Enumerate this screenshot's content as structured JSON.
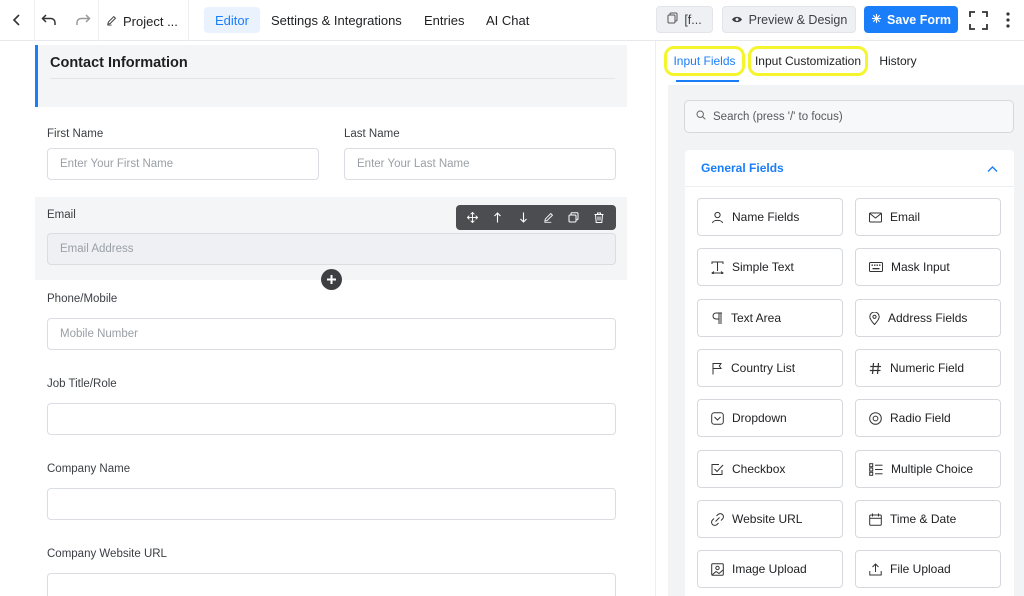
{
  "topbar": {
    "project_name": "Project ...",
    "tabs": [
      "Editor",
      "Settings & Integrations",
      "Entries",
      "AI Chat"
    ],
    "shortcode_label": "[f...",
    "preview_label": "Preview & Design",
    "save_label": "Save Form"
  },
  "form": {
    "section_title": "Contact Information",
    "first_name_label": "First Name",
    "first_name_placeholder": "Enter Your First Name",
    "last_name_label": "Last Name",
    "last_name_placeholder": "Enter Your Last Name",
    "email_label": "Email",
    "email_placeholder": "Email Address",
    "phone_label": "Phone/Mobile",
    "phone_placeholder": "Mobile Number",
    "job_label": "Job Title/Role",
    "company_label": "Company Name",
    "website_label": "Company Website URL"
  },
  "panel": {
    "tabs": [
      "Input Fields",
      "Input Customization",
      "History"
    ],
    "search_placeholder": "Search (press '/' to focus)",
    "group_title": "General Fields",
    "fields": [
      {
        "label": "Name Fields",
        "icon": "user-icon"
      },
      {
        "label": "Email",
        "icon": "mail-icon"
      },
      {
        "label": "Simple Text",
        "icon": "text-icon"
      },
      {
        "label": "Mask Input",
        "icon": "keyboard-icon"
      },
      {
        "label": "Text Area",
        "icon": "paragraph-icon"
      },
      {
        "label": "Address Fields",
        "icon": "location-pin-icon"
      },
      {
        "label": "Country List",
        "icon": "flag-icon"
      },
      {
        "label": "Numeric Field",
        "icon": "hash-icon"
      },
      {
        "label": "Dropdown",
        "icon": "dropdown-icon"
      },
      {
        "label": "Radio Field",
        "icon": "radio-icon"
      },
      {
        "label": "Checkbox",
        "icon": "checkbox-icon"
      },
      {
        "label": "Multiple Choice",
        "icon": "list-icon"
      },
      {
        "label": "Website URL",
        "icon": "link-icon"
      },
      {
        "label": "Time & Date",
        "icon": "calendar-icon"
      },
      {
        "label": "Image Upload",
        "icon": "image-icon"
      },
      {
        "label": "File Upload",
        "icon": "upload-icon"
      }
    ]
  },
  "colors": {
    "accent": "#1a7efb",
    "highlight": "#f4f52c"
  }
}
